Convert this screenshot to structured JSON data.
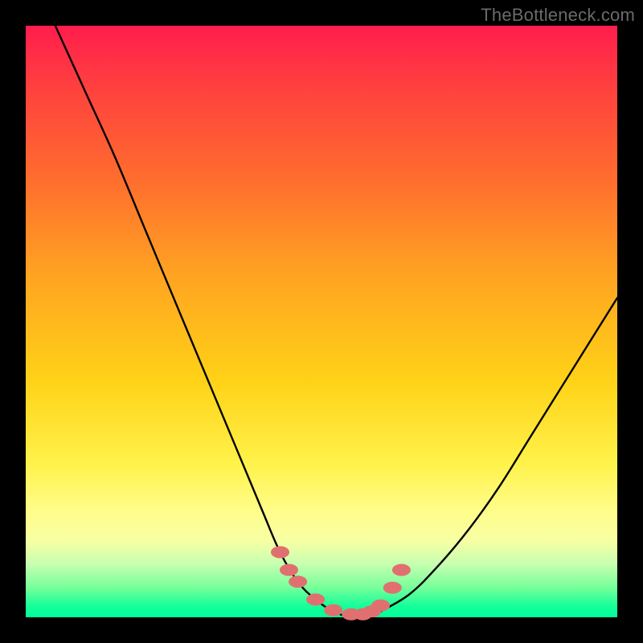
{
  "watermark": "TheBottleneck.com",
  "chart_data": {
    "type": "line",
    "title": "",
    "xlabel": "",
    "ylabel": "",
    "xlim": [
      0,
      100
    ],
    "ylim": [
      0,
      100
    ],
    "grid": false,
    "legend": false,
    "series": [
      {
        "name": "bottleneck-curve",
        "x": [
          5,
          10,
          15,
          20,
          25,
          30,
          35,
          40,
          43,
          46,
          49,
          52,
          55,
          58,
          60,
          65,
          70,
          75,
          80,
          85,
          90,
          95,
          100
        ],
        "values": [
          100,
          89,
          78,
          66,
          54,
          42,
          30,
          18,
          11,
          6,
          3,
          1,
          0,
          0,
          1,
          4,
          9,
          15,
          22,
          30,
          38,
          46,
          54
        ]
      }
    ],
    "markers": {
      "name": "highlight-points",
      "x": [
        43,
        44.5,
        46,
        49,
        52,
        55,
        57,
        58.5,
        60,
        62,
        63.5
      ],
      "values": [
        11,
        8,
        6,
        3,
        1.2,
        0.5,
        0.5,
        1,
        2,
        5,
        8
      ]
    },
    "background_gradient": {
      "top": "#ff1d4d",
      "mid": "#ffd217",
      "bottom": "#00ff99"
    }
  }
}
